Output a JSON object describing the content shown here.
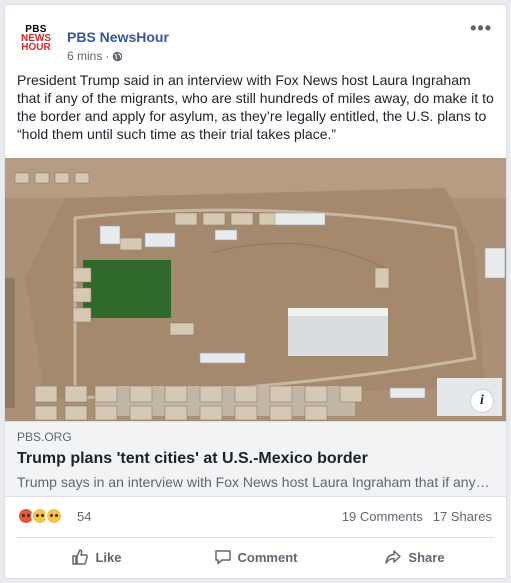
{
  "post": {
    "page_name": "PBS NewsHour",
    "time": "6 mins",
    "separator": "·",
    "logo": {
      "line1": "PBS",
      "line2": "NEWS",
      "line3": "HOUR"
    },
    "more": "•••",
    "body": "President Trump said in an interview with Fox News host Laura Ingraham that if any of the migrants, who are still hundreds of miles away, do make it to the border and apply for asylum, as they’re legally entitled, the U.S. plans to “hold them until such time as their trial takes place.”"
  },
  "link": {
    "domain": "PBS.ORG",
    "title": "Trump plans 'tent cities' at U.S.-Mexico border",
    "description": "Trump says in an interview with Fox News host Laura Ingraham that if any…",
    "info": "i"
  },
  "reactions": {
    "count": "54",
    "comments": "19 Comments",
    "shares": "17 Shares"
  },
  "actions": {
    "like": "Like",
    "comment": "Comment",
    "share": "Share"
  },
  "colors": {
    "page_name": "#365899",
    "meta": "#606770",
    "link_bg": "#f2f3f5"
  }
}
